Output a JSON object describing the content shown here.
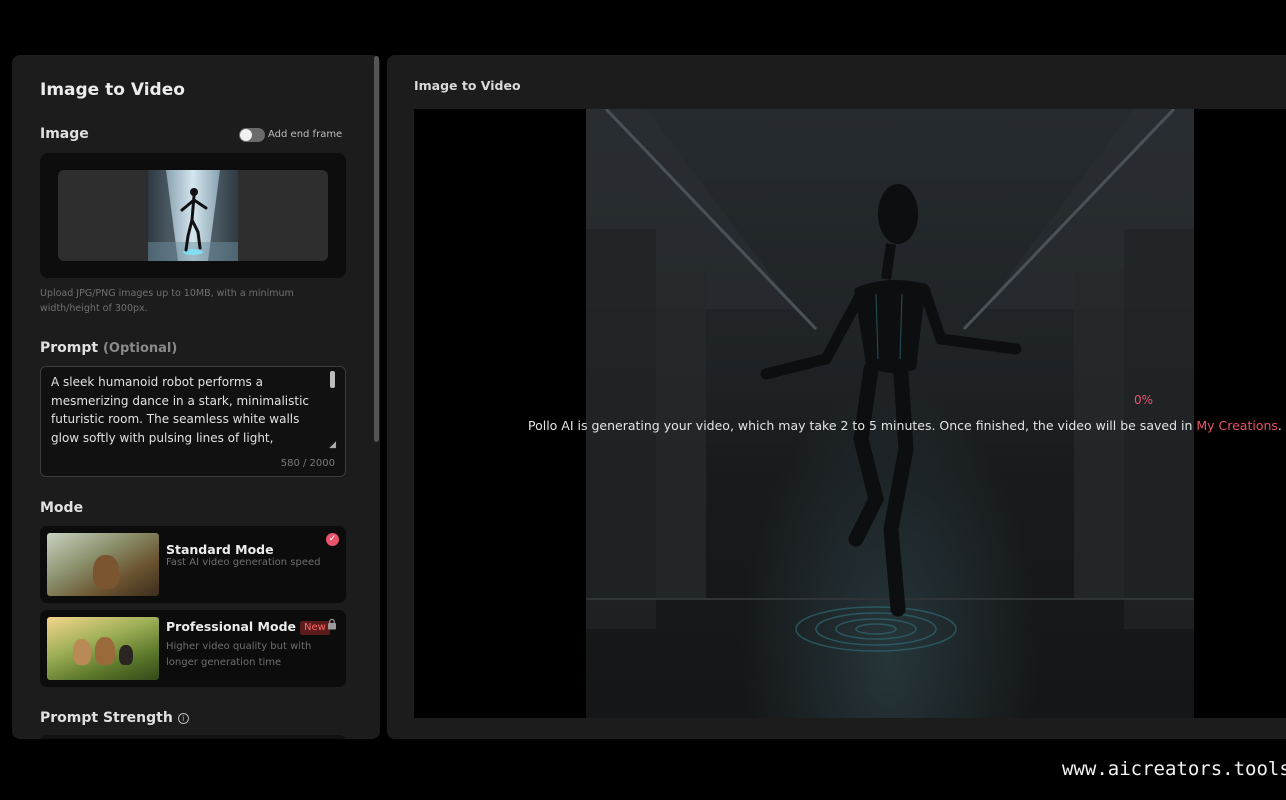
{
  "left_panel": {
    "title": "Image to Video",
    "image_section": {
      "label": "Image",
      "end_frame_toggle": {
        "label": "Add end frame",
        "enabled": false
      },
      "upload_hint": "Upload JPG/PNG images up to 10MB, with a minimum width/height of 300px."
    },
    "prompt_section": {
      "label": "Prompt",
      "optional_label": "(Optional)",
      "value": "A sleek humanoid robot performs a mesmerizing dance in a stark, minimalistic futuristic room. The seamless white walls glow softly with pulsing lines of light,",
      "char_count": "580 / 2000"
    },
    "mode_section": {
      "label": "Mode",
      "modes": [
        {
          "name": "Standard Mode",
          "description": "Fast AI video generation speed",
          "selected": true,
          "icon": "check-circle-icon"
        },
        {
          "name": "Professional Mode",
          "badge": "New",
          "description": "Higher video quality but with longer generation time",
          "locked": true,
          "icon": "lock-icon"
        }
      ]
    },
    "prompt_strength": {
      "label": "Prompt Strength",
      "icon": "info-icon"
    }
  },
  "right_panel": {
    "title": "Image to Video",
    "progress_text": "0%",
    "progress_value": 0,
    "message": "Pollo AI is generating your video, which may take 2 to 5 minutes. Once finished, the video will be saved in ",
    "message_link": "My Creations",
    "message_suffix": "."
  },
  "watermark": "www.aicreators.tools",
  "colors": {
    "background": "#000000",
    "panel": "#1c1c1c",
    "accent": "#e8546a",
    "muted_text": "#707070"
  }
}
